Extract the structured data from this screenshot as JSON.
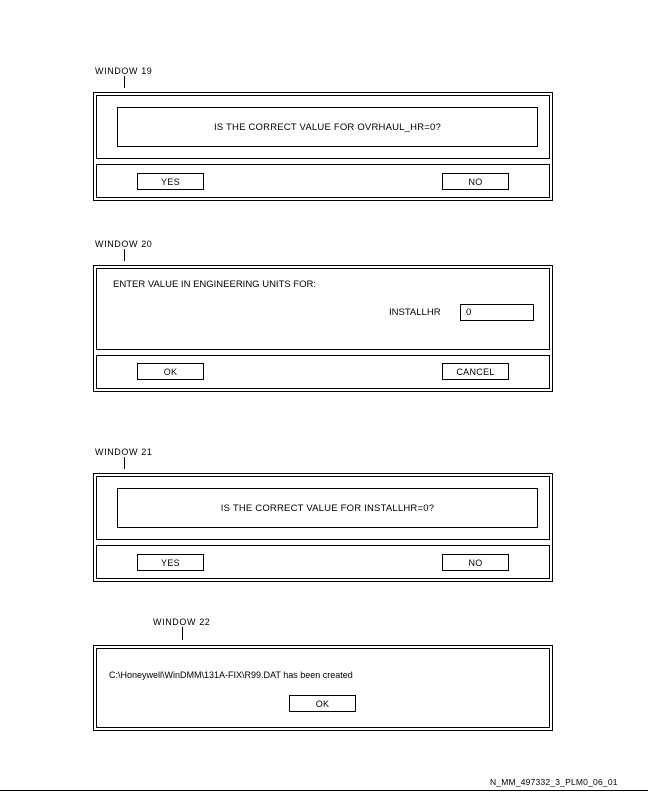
{
  "windows": [
    {
      "label": "WINDOW 19",
      "message": "IS THE CORRECT VALUE FOR OVRHAUL_HR=0?",
      "buttons": {
        "left": "YES",
        "right": "NO"
      }
    },
    {
      "label": "WINDOW 20",
      "prompt": "ENTER VALUE IN ENGINEERING UNITS FOR:",
      "field_label": "INSTALLHR",
      "field_value": "0",
      "buttons": {
        "left": "OK",
        "right": "CANCEL"
      }
    },
    {
      "label": "WINDOW 21",
      "message": "IS THE CORRECT VALUE FOR INSTALLHR=0?",
      "buttons": {
        "left": "YES",
        "right": "NO"
      }
    },
    {
      "label": "WINDOW 22",
      "message": "C:\\Honeywell\\WinDMM\\131A-FIX\\R99.DAT has been created",
      "buttons": {
        "center": "OK"
      }
    }
  ],
  "figure_id": "N_MM_497332_3_PLM0_06_01"
}
